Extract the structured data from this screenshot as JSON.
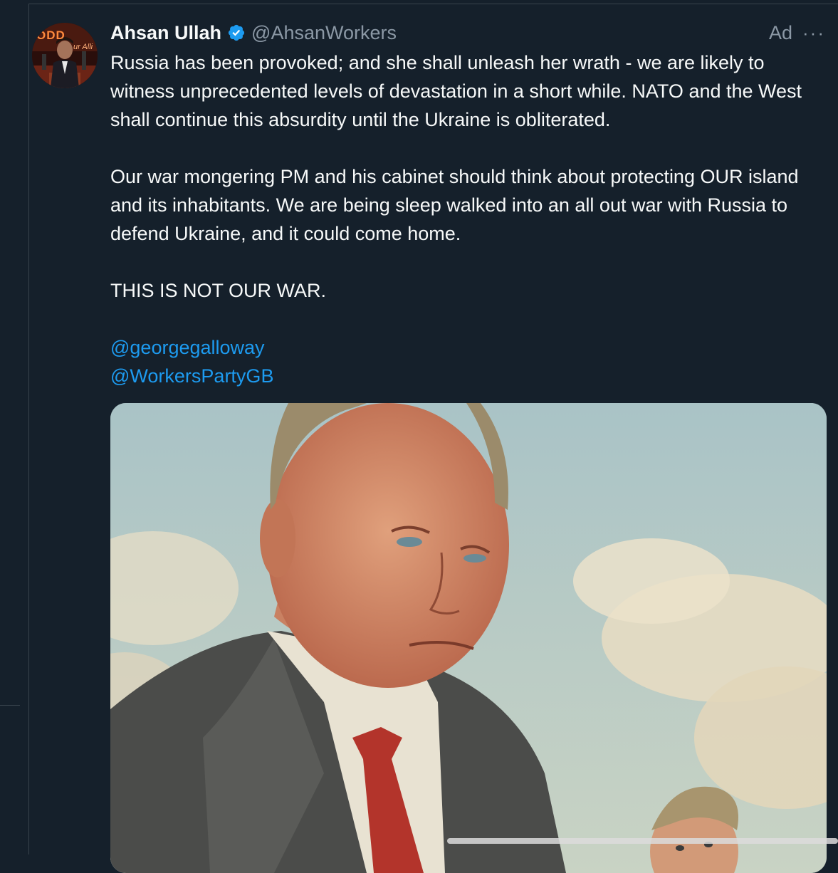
{
  "post": {
    "author_name": "Ahsan Ullah",
    "author_handle": "@AhsanWorkers",
    "ad_label": "Ad",
    "more_label": "···",
    "avatar_logo_text": "ODD",
    "avatar_logo_subtext": "ur Alli",
    "paragraphs": [
      "Russia has been provoked; and she shall unleash her wrath - we are likely to witness unprecedented levels of devastation in a short while. NATO and the West shall continue this absurdity until the Ukraine is obliterated.",
      "Our war mongering PM and his cabinet should think about protecting OUR island and its inhabitants. We are being sleep walked into an all out war with Russia to defend Ukraine, and it could come home.",
      "THIS IS NOT OUR WAR."
    ],
    "mentions": [
      "@georgegalloway",
      "@WorkersPartyGB"
    ]
  },
  "icons": {
    "verified": "verified-badge-icon",
    "more": "more-options-icon"
  },
  "colors": {
    "background": "#15202b",
    "text": "#f7f9f9",
    "secondary_text": "#8b98a5",
    "link": "#1d9bf0",
    "verified": "#1d9bf0",
    "divider": "#38444d"
  }
}
